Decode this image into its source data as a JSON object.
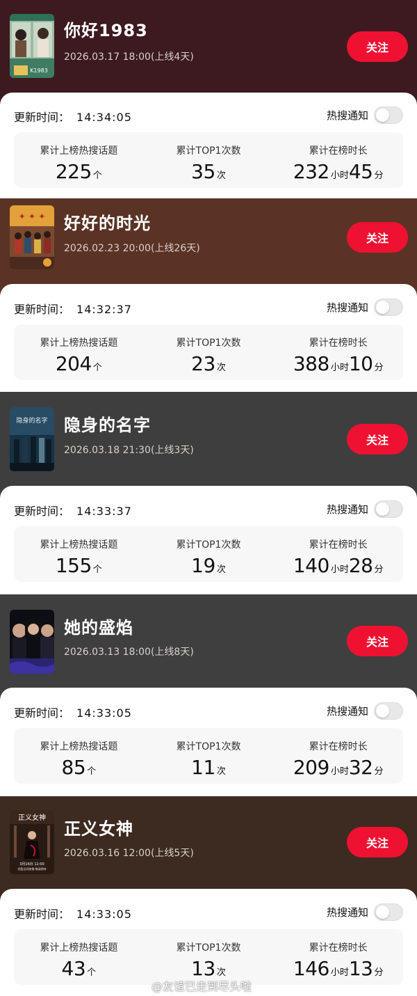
{
  "colors": {
    "follow_button": "#ee1132",
    "header_1": "#3c1a1f",
    "header_2": "#5a3324",
    "header_3": "#3e3e3e",
    "header_4": "#3f3f3f",
    "header_5": "#3d2a21"
  },
  "labels": {
    "follow": "关注",
    "update_prefix": "更新时间：",
    "hot_notify": "热搜通知",
    "stat_topics": "累计上榜热搜话题",
    "stat_top1": "累计TOP1次数",
    "stat_duration": "累计在榜时长",
    "unit_topics": "个",
    "unit_top1": "次",
    "unit_hours": "小时",
    "unit_minutes": "分"
  },
  "shows": [
    {
      "title": "你好1983",
      "date": "2026.03.17 18:00(上线4天)",
      "update_time": "14:34:05",
      "topics": "225",
      "top1": "35",
      "hours": "232",
      "minutes": "45",
      "notify_on": false
    },
    {
      "title": "好好的时光",
      "date": "2026.02.23 20:00(上线26天)",
      "update_time": "14:32:37",
      "topics": "204",
      "top1": "23",
      "hours": "388",
      "minutes": "10",
      "notify_on": false
    },
    {
      "title": "隐身的名字",
      "date": "2026.03.18 21:30(上线3天)",
      "update_time": "14:33:37",
      "topics": "155",
      "top1": "19",
      "hours": "140",
      "minutes": "28",
      "notify_on": false
    },
    {
      "title": "她的盛焰",
      "date": "2026.03.13 18:00(上线8天)",
      "update_time": "14:33:05",
      "topics": "85",
      "top1": "11",
      "hours": "209",
      "minutes": "32",
      "notify_on": false
    },
    {
      "title": "正义女神",
      "date": "2026.03.16 12:00(上线5天)",
      "update_time": "14:33:05",
      "topics": "43",
      "top1": "13",
      "hours": "146",
      "minutes": "13",
      "notify_on": false
    }
  ],
  "poster_texts": {
    "poster_1": "K1983",
    "poster_5_title": "正义女神",
    "poster_5_date": "3月16日 12:00",
    "poster_5_sub": "优酷全网独播 敬请期待"
  },
  "watermark": "@友谊已走到尽头啦"
}
